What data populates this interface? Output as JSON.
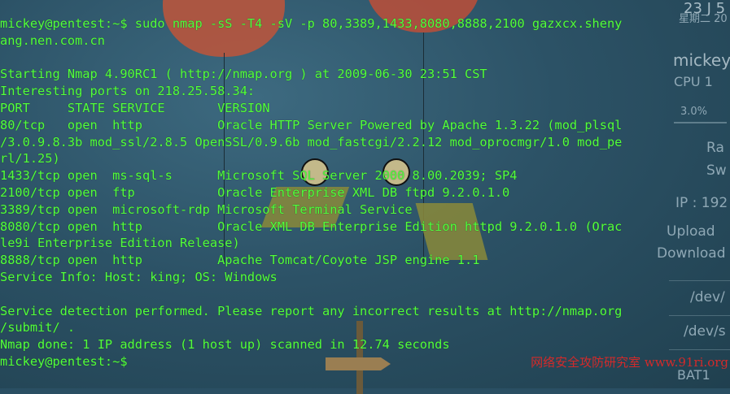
{
  "wallpaper_sidebar": {
    "date": "23 J 5",
    "weekday": "星期二 20",
    "user": "mickey",
    "cpu_label": "CPU 1",
    "cpu_percent": "3.0%",
    "ram_label": "Ra",
    "swap_label": "Sw",
    "ip_label": "IP : 192",
    "upload_label": "Upload",
    "download_label": "Download",
    "dev1": "/dev/",
    "dev2": "/dev/s",
    "bat": "BAT1"
  },
  "terminal": {
    "lines": [
      "mickey@pentest:~$ sudo nmap -sS -T4 -sV -p 80,3389,1433,8080,8888,2100 gazxcx.sheny",
      "ang.nen.com.cn",
      "",
      "Starting Nmap 4.90RC1 ( http://nmap.org ) at 2009-06-30 23:51 CST",
      "Interesting ports on 218.25.58.34:",
      "PORT     STATE SERVICE       VERSION",
      "80/tcp   open  http          Oracle HTTP Server Powered by Apache 1.3.22 (mod_plsql",
      "/3.0.9.8.3b mod_ssl/2.8.5 OpenSSL/0.9.6b mod_fastcgi/2.2.12 mod_oprocmgr/1.0 mod_pe",
      "rl/1.25)",
      "1433/tcp open  ms-sql-s      Microsoft SQL Server 2000 8.00.2039; SP4",
      "2100/tcp open  ftp           Oracle Enterprise XML DB ftpd 9.2.0.1.0",
      "3389/tcp open  microsoft-rdp Microsoft Terminal Service",
      "8080/tcp open  http          Oracle XML DB Enterprise Edition httpd 9.2.0.1.0 (Orac",
      "le9i Enterprise Edition Release)",
      "8888/tcp open  http          Apache Tomcat/Coyote JSP engine 1.1",
      "Service Info: Host: king; OS: Windows",
      "",
      "Service detection performed. Please report any incorrect results at http://nmap.org",
      "/submit/ .",
      "Nmap done: 1 IP address (1 host up) scanned in 12.74 seconds",
      "mickey@pentest:~$"
    ]
  },
  "watermark": "网络安全攻防研究室 www.91ri.org",
  "colors": {
    "terminal_text": "#52ff3d",
    "background": "#2a4f63",
    "watermark": "#d32a2a"
  }
}
